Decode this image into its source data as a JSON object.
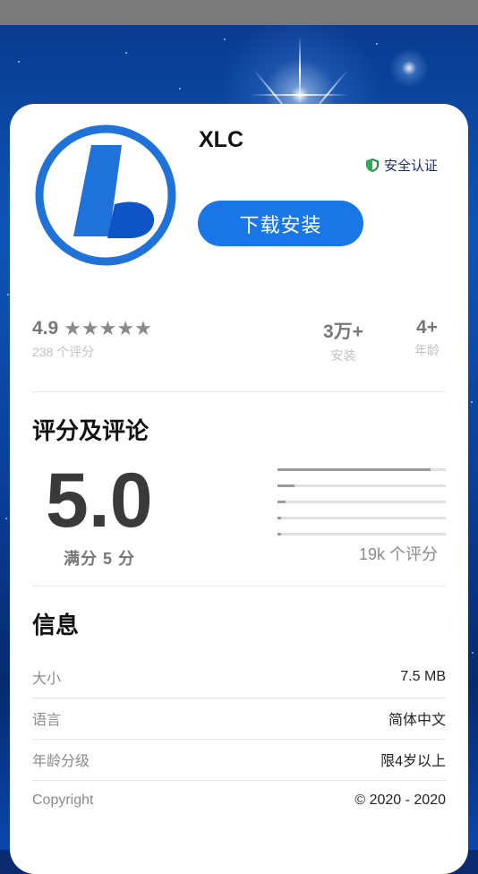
{
  "app": {
    "name": "XLC",
    "badge": "安全认证",
    "download_label": "下载安装",
    "accent_color": "#1976e6",
    "icon": "xlc-logo-icon"
  },
  "stats": {
    "rating": "4.9",
    "stars": "★★★★★",
    "rating_count": "238 个评分",
    "installs": "3万+",
    "installs_label": "安装",
    "age": "4+",
    "age_label": "年龄"
  },
  "reviews": {
    "title": "评分及评论",
    "score": "5.0",
    "out_of": "满分 5 分",
    "distribution": [
      0.91,
      0.1,
      0.05,
      0.02,
      0.02
    ],
    "total": "19k 个评分"
  },
  "info": {
    "title": "信息",
    "rows": [
      {
        "key": "大小",
        "value": "7.5 MB"
      },
      {
        "key": "语言",
        "value": "简体中文"
      },
      {
        "key": "年龄分级",
        "value": "限4岁以上"
      },
      {
        "key": "Copyright",
        "value": "© 2020 - 2020"
      }
    ]
  }
}
